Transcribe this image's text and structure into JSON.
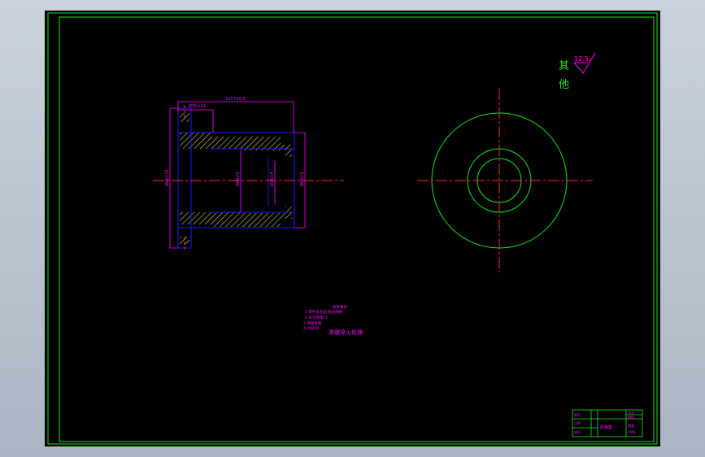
{
  "colors": {
    "frame": "#19e619",
    "part_outline": "#1a1aff",
    "dim": "#ff00ff",
    "center": "#ff2a2a",
    "hatch": "#ffff55",
    "circle": "#19e619",
    "annotation_green": "#19e619",
    "background": "#000000"
  },
  "roughness": {
    "label_line1": "其",
    "label_line2": "他",
    "value": "12.5"
  },
  "dimensions": {
    "top_long": "2257±0.0",
    "top_short": "Ø35±12",
    "left_dia": "Ø66±12",
    "mid_dia": "Ø60±5",
    "inner_dia": "Ø26±4",
    "right_dia": "Ø60±5"
  },
  "notes": {
    "lines": [
      "技术要求",
      "1.零件去毛刺,锐边倒钝",
      "2.未注倒角C1",
      "3.调质处理",
      "4.HB200"
    ],
    "footer": "渗碳淬火处理"
  },
  "title_block": {
    "cells": [
      "图号",
      "比例",
      "材料",
      "设计",
      "审核",
      "数量"
    ],
    "name": "阶梯套",
    "code": "45钢"
  }
}
